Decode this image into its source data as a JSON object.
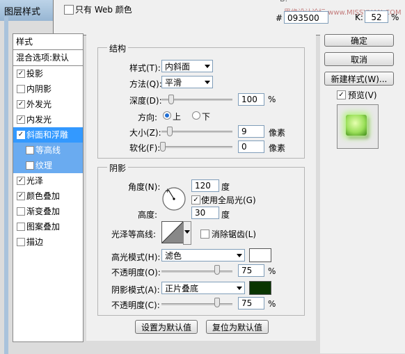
{
  "window": {
    "title": "图层样式"
  },
  "picker": {
    "web_only_label": "只有 Web 颜色",
    "hex_hash": "#",
    "hex_value": "093500",
    "k_label": "K:",
    "k_value": "52",
    "k_unit": "%",
    "b_top": "B:",
    "watermark": "思缘设计论坛 www.MISSYUAN.COM"
  },
  "sidebar": {
    "header": "样式",
    "blend": "混合选项:默认",
    "items": [
      {
        "label": "投影",
        "check": "✓"
      },
      {
        "label": "内阴影",
        "check": ""
      },
      {
        "label": "外发光",
        "check": "✓"
      },
      {
        "label": "内发光",
        "check": "✓"
      },
      {
        "label": "斜面和浮雕",
        "check": "✓"
      },
      {
        "label": "等高线",
        "check": ""
      },
      {
        "label": "纹理",
        "check": ""
      },
      {
        "label": "光泽",
        "check": "✓"
      },
      {
        "label": "颜色叠加",
        "check": "✓"
      },
      {
        "label": "渐变叠加",
        "check": ""
      },
      {
        "label": "图案叠加",
        "check": ""
      },
      {
        "label": "描边",
        "check": ""
      }
    ]
  },
  "structure": {
    "group_label": "结构",
    "style_label": "样式(T):",
    "style_value": "内斜面",
    "method_label": "方法(Q):",
    "method_value": "平滑",
    "depth_label": "深度(D):",
    "depth_value": "100",
    "depth_unit": "%",
    "depth_fraction": 0.1,
    "direction_label": "方向:",
    "dir_up": "上",
    "dir_down": "下",
    "size_label": "大小(Z):",
    "size_value": "9",
    "size_unit": "像素",
    "soften_label": "软化(F):",
    "soften_value": "0",
    "soften_unit": "像素"
  },
  "shading": {
    "group_label": "阴影",
    "angle_label": "角度(N):",
    "angle_value": "120",
    "angle_unit": "度",
    "global_light_label": "使用全局光(G)",
    "global_light_check": "✓",
    "altitude_label": "高度:",
    "altitude_value": "30",
    "altitude_unit": "度",
    "gloss_label": "光泽等高线:",
    "antialias_label": "消除锯齿(L)",
    "highlight_mode_label": "高光模式(H):",
    "highlight_mode_value": "滤色",
    "highlight_color": "#ffffff",
    "opacity1_label": "不透明度(O):",
    "opacity1_value": "75",
    "opacity1_unit": "%",
    "shadow_mode_label": "阴影模式(A):",
    "shadow_mode_value": "正片叠底",
    "shadow_color": "#093500",
    "opacity2_label": "不透明度(C):",
    "opacity2_value": "75",
    "opacity2_unit": "%"
  },
  "footer": {
    "make_default": "设置为默认值",
    "reset_default": "复位为默认值"
  },
  "right": {
    "ok": "确定",
    "cancel": "取消",
    "new_style": "新建样式(W)...",
    "preview_label": "预览(V)",
    "preview_check": "✓"
  }
}
